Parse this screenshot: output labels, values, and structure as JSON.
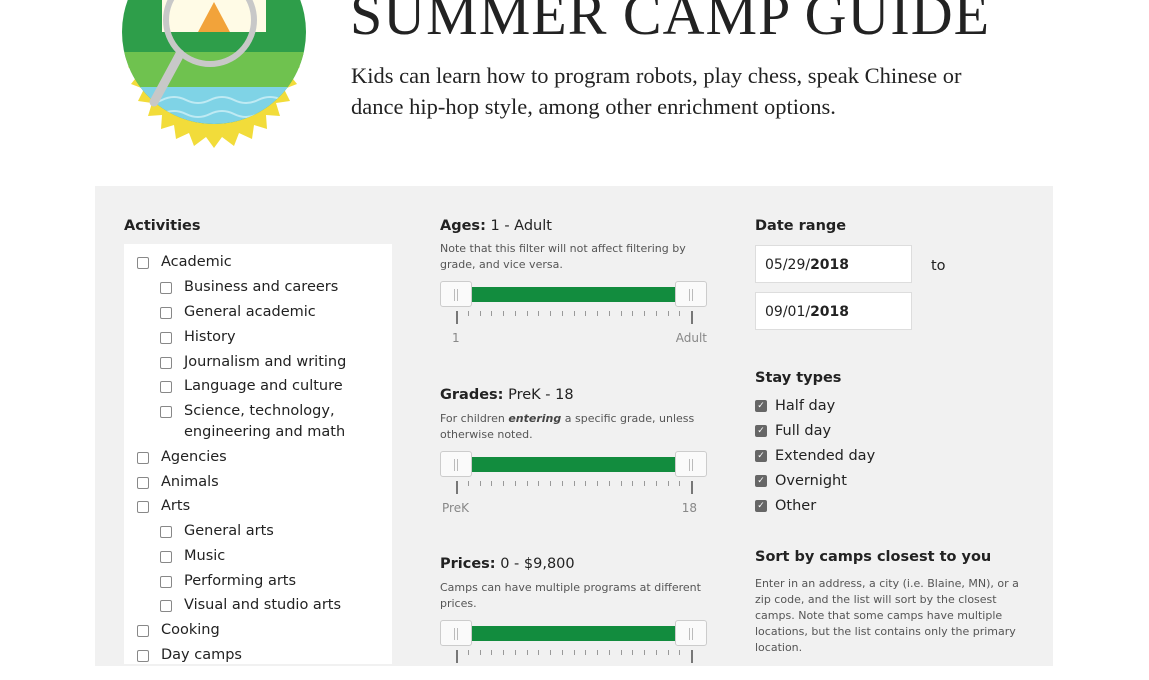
{
  "header": {
    "title": "SUMMER CAMP GUIDE",
    "subtitle": "Kids can learn how to program robots, play chess, speak Chinese or dance hip-hop style, among other enrichment options."
  },
  "activities": {
    "title": "Activities",
    "items": [
      {
        "label": "Academic",
        "level": 0
      },
      {
        "label": "Business and careers",
        "level": 1
      },
      {
        "label": "General academic",
        "level": 1
      },
      {
        "label": "History",
        "level": 1
      },
      {
        "label": "Journalism and writing",
        "level": 1
      },
      {
        "label": "Language and culture",
        "level": 1
      },
      {
        "label": "Science, technology, engineering and math",
        "level": 1
      },
      {
        "label": "Agencies",
        "level": 0
      },
      {
        "label": "Animals",
        "level": 0
      },
      {
        "label": "Arts",
        "level": 0
      },
      {
        "label": "General arts",
        "level": 1
      },
      {
        "label": "Music",
        "level": 1
      },
      {
        "label": "Performing arts",
        "level": 1
      },
      {
        "label": "Visual and studio arts",
        "level": 1
      },
      {
        "label": "Cooking",
        "level": 0
      },
      {
        "label": "Day camps",
        "level": 0
      }
    ]
  },
  "filters": {
    "ages": {
      "label": "Ages:",
      "value": "1 - Adult",
      "note": "Note that this filter will not affect filtering by grade, and vice versa.",
      "min_label": "1",
      "max_label": "Adult",
      "range": [
        0,
        1
      ]
    },
    "grades": {
      "label": "Grades:",
      "value": "PreK - 18",
      "note_pre": "For children ",
      "note_em": "entering",
      "note_post": " a specific grade, unless otherwise noted.",
      "min_label": "PreK",
      "max_label": "18",
      "range": [
        0,
        1
      ]
    },
    "prices": {
      "label": "Prices:",
      "value": "0 - $9,800",
      "note": "Camps can have multiple programs at different prices.",
      "range": [
        0,
        1
      ]
    }
  },
  "date_range": {
    "title": "Date range",
    "start_md": "05/29/",
    "start_year": "2018",
    "end_md": "09/01/",
    "end_year": "2018",
    "to": "to"
  },
  "stay_types": {
    "title": "Stay types",
    "items": [
      "Half day",
      "Full day",
      "Extended day",
      "Overnight",
      "Other"
    ]
  },
  "sort": {
    "title": "Sort by camps closest to you",
    "note": "Enter in an address, a city (i.e. Blaine, MN), or a zip code, and the list will sort by the closest camps. Note that some camps have multiple locations, but the list contains only the primary location."
  },
  "colors": {
    "accent": "#128c3e",
    "panel": "#f1f1f1",
    "badge_gold": "#f2dc3a",
    "badge_green": "#2e9e4a",
    "water": "#7fd3e6"
  }
}
